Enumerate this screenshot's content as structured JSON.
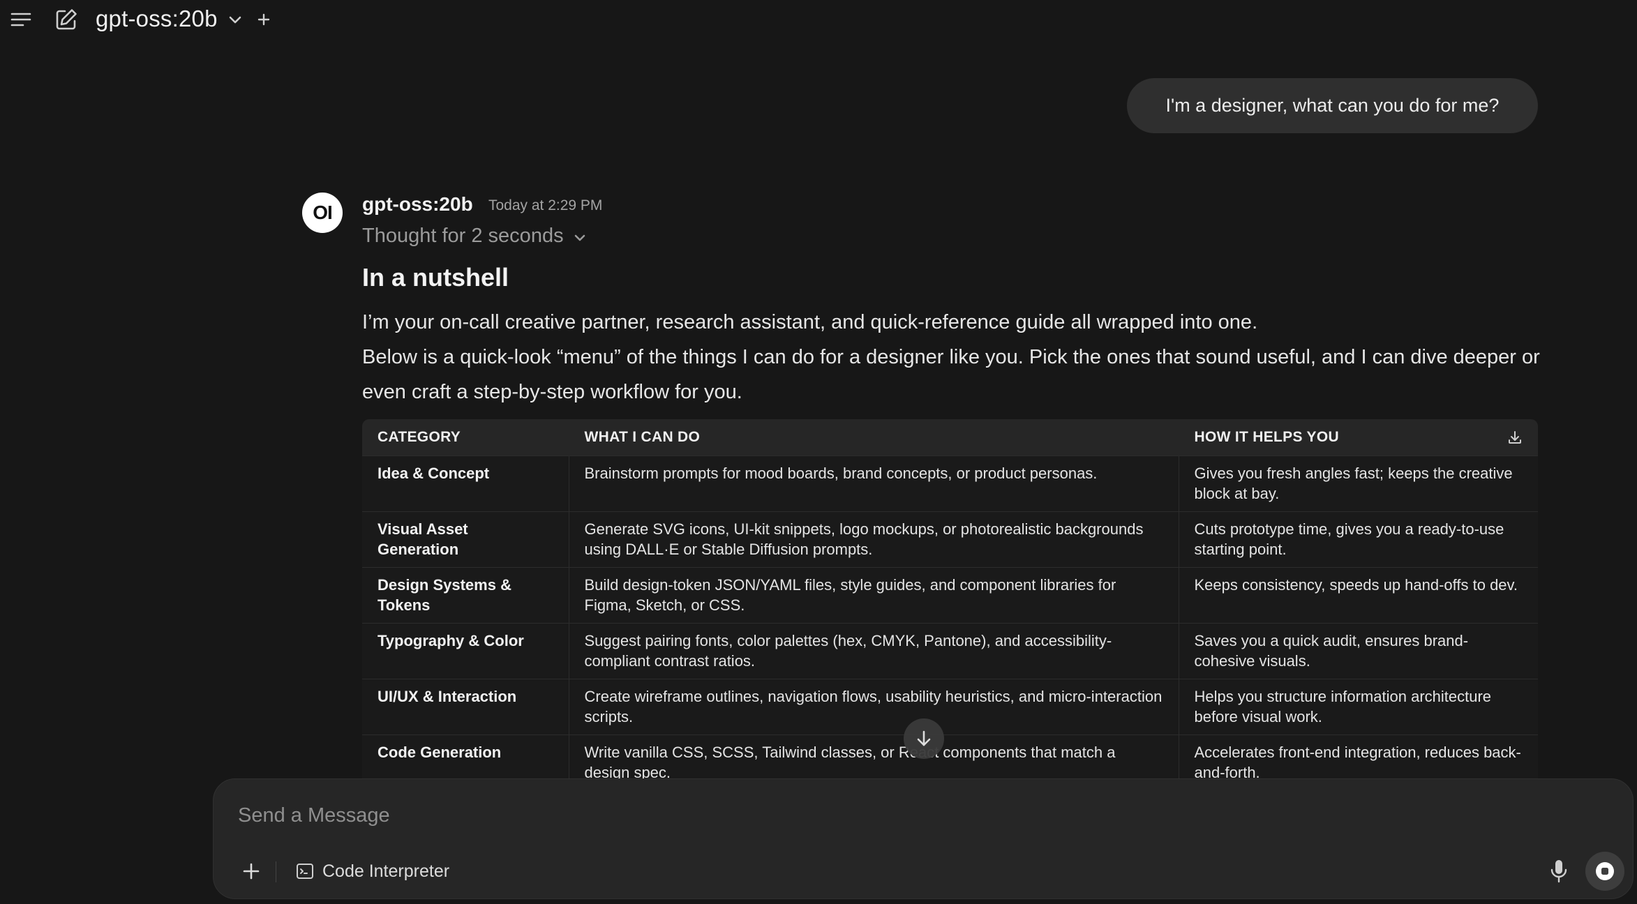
{
  "header": {
    "model_name": "gpt-oss:20b",
    "icons": [
      "menu-icon",
      "edit-icon",
      "chevron-down-icon",
      "plus-icon"
    ]
  },
  "user_message": {
    "text": "I'm a designer, what can you do for me?"
  },
  "assistant_message": {
    "avatar_text": "OI",
    "model_name": "gpt-oss:20b",
    "timestamp": "Today at 2:29 PM",
    "thought_label": "Thought for 2 seconds",
    "heading": "In a nutshell",
    "paragraph1": "I’m your on-call creative partner, research assistant, and quick-reference guide all wrapped into one.",
    "paragraph2": "Below is a quick-look “menu” of the things I can do for a designer like you. Pick the ones that sound useful, and I can dive deeper or even craft a step-by-step workflow for you.",
    "table": {
      "headers": [
        "CATEGORY",
        "WHAT I CAN DO",
        "HOW IT HELPS YOU"
      ],
      "rows": [
        {
          "category": "Idea & Concept",
          "what": "Brainstorm prompts for mood boards, brand concepts, or product personas.",
          "how": "Gives you fresh angles fast; keeps the creative block at bay."
        },
        {
          "category": "Visual Asset Generation",
          "what": "Generate SVG icons, UI-kit snippets, logo mockups, or photorealistic backgrounds using DALL·E or Stable Diffusion prompts.",
          "how": "Cuts prototype time, gives you a ready-to-use starting point."
        },
        {
          "category": "Design Systems & Tokens",
          "what": "Build design-token JSON/YAML files, style guides, and component libraries for Figma, Sketch, or CSS.",
          "how": "Keeps consistency, speeds up hand-offs to dev."
        },
        {
          "category": "Typography & Color",
          "what": "Suggest pairing fonts, color palettes (hex, CMYK, Pantone), and accessibility-compliant contrast ratios.",
          "how": "Saves you a quick audit, ensures brand-cohesive visuals."
        },
        {
          "category": "UI/UX & Interaction",
          "what": "Create wireframe outlines, navigation flows, usability heuristics, and micro-interaction scripts.",
          "how": "Helps you structure information architecture before visual work."
        },
        {
          "category": "Code Generation",
          "what": "Write vanilla CSS, SCSS, Tailwind classes, or React components that match a design spec.",
          "how": "Accelerates front-end integration, reduces back-and-forth."
        }
      ]
    }
  },
  "composer": {
    "placeholder": "Send a Message",
    "value": "",
    "tool_label": "Code Interpreter"
  },
  "colors": {
    "background": "#171717",
    "bubble": "#2f2f2f",
    "composer": "#262626",
    "muted_text": "#9b9b9b"
  }
}
